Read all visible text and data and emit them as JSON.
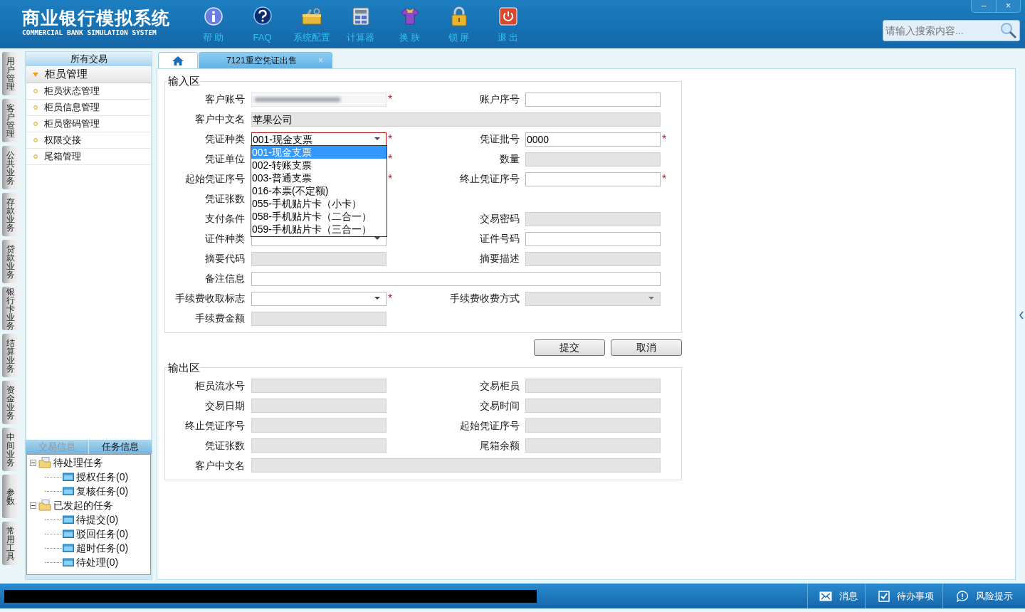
{
  "header": {
    "title": "商业银行模拟系统",
    "subtitle": "COMMERCIAL BANK SIMULATION SYSTEM",
    "toolbar": [
      {
        "label": "帮 助"
      },
      {
        "label": "FAQ"
      },
      {
        "label": "系统配置"
      },
      {
        "label": "计算器"
      },
      {
        "label": "换 肤"
      },
      {
        "label": "锁 屏"
      },
      {
        "label": "退 出"
      }
    ],
    "window_controls": [
      "–",
      "×"
    ],
    "search": {
      "placeholder": "请输入搜索内容..."
    }
  },
  "side_tabs": [
    {
      "label": "用户管理"
    },
    {
      "label": "客户管理"
    },
    {
      "label": "公共业务"
    },
    {
      "label": "存款业务"
    },
    {
      "label": "贷款业务"
    },
    {
      "label": "银行卡业务"
    },
    {
      "label": "结算业务"
    },
    {
      "label": "资金业务"
    },
    {
      "label": "中间业务"
    },
    {
      "label": "参数"
    },
    {
      "label": "常用工具"
    }
  ],
  "sidebar": {
    "title": "所有交易",
    "group": {
      "label": "柜员管理",
      "expanded": true,
      "items": [
        "柜员状态管理",
        "柜员信息管理",
        "柜员密码管理",
        "权限交接",
        "尾箱管理"
      ]
    },
    "info_tabs": [
      {
        "label": "交易信息",
        "selected": false
      },
      {
        "label": "任务信息",
        "selected": true
      }
    ],
    "tree": [
      {
        "label": "待处理任务",
        "expanded": true,
        "children": [
          {
            "label": "授权任务(0)"
          },
          {
            "label": "复核任务(0)"
          }
        ]
      },
      {
        "label": "已发起的任务",
        "expanded": true,
        "children": [
          {
            "label": "待提交(0)"
          },
          {
            "label": "驳回任务(0)"
          },
          {
            "label": "超时任务(0)"
          },
          {
            "label": "待处理(0)"
          }
        ]
      }
    ]
  },
  "tabs": [
    {
      "kind": "home",
      "selected": false
    },
    {
      "kind": "text",
      "label": "7121重空凭证出售",
      "close": "×",
      "selected": true
    }
  ],
  "required_mark": "*",
  "input_area": {
    "title": "输入区",
    "rows": [
      {
        "left": {
          "label": "客户账号",
          "kind": "masked",
          "required": true
        },
        "right": {
          "label": "账户序号",
          "kind": "text",
          "disabled": false
        }
      },
      {
        "wide": {
          "label": "客户中文名",
          "kind": "text",
          "value": "苹果公司",
          "disabled": true
        }
      },
      {
        "left": {
          "label": "凭证种类",
          "kind": "select",
          "value": "001-现金支票",
          "disabled": false,
          "required": true,
          "open": true,
          "options": [
            {
              "label": "001-现金支票",
              "selected": true
            },
            {
              "label": "002-转账支票",
              "selected": false
            },
            {
              "label": "003-普通支票",
              "selected": false
            },
            {
              "label": "016-本票(不定额)",
              "selected": false
            },
            {
              "label": "055-手机贴片卡（小卡）",
              "selected": false
            },
            {
              "label": "058-手机贴片卡（二合一）",
              "selected": false
            },
            {
              "label": "059-手机贴片卡（三合一）",
              "selected": false
            }
          ]
        },
        "right": {
          "label": "凭证批号",
          "kind": "text",
          "value": "0000",
          "disabled": false,
          "required": true
        }
      },
      {
        "left": {
          "label": "凭证单位",
          "kind": "covered",
          "required": true
        },
        "right": {
          "label": "数量",
          "kind": "text",
          "disabled": true
        }
      },
      {
        "left": {
          "label": "起始凭证序号",
          "kind": "covered",
          "required": true
        },
        "right": {
          "label": "终止凭证序号",
          "kind": "text",
          "disabled": false,
          "required": true
        }
      },
      {
        "left": {
          "label": "凭证张数",
          "kind": "covered"
        }
      },
      {
        "left": {
          "label": "支付条件",
          "kind": "covered"
        },
        "right": {
          "label": "交易密码",
          "kind": "text",
          "disabled": true
        }
      },
      {
        "left": {
          "label": "证件种类",
          "kind": "select",
          "disabled": false
        },
        "right": {
          "label": "证件号码",
          "kind": "text",
          "disabled": false
        }
      },
      {
        "left": {
          "label": "摘要代码",
          "kind": "text",
          "disabled": true
        },
        "right": {
          "label": "摘要描述",
          "kind": "text",
          "disabled": true
        }
      },
      {
        "wide": {
          "label": "备注信息",
          "kind": "text",
          "disabled": false
        }
      },
      {
        "left": {
          "label": "手续费收取标志",
          "kind": "select",
          "disabled": false,
          "required": true
        },
        "right": {
          "label": "手续费收费方式",
          "kind": "select",
          "disabled": true
        }
      },
      {
        "left": {
          "label": "手续费金额",
          "kind": "text",
          "disabled": true
        }
      }
    ]
  },
  "buttons": [
    "提交",
    "取消"
  ],
  "output_area": {
    "title": "输出区",
    "rows": [
      {
        "left": {
          "label": "柜员流水号",
          "kind": "text",
          "disabled": true
        },
        "right": {
          "label": "交易柜员",
          "kind": "text",
          "disabled": true
        }
      },
      {
        "left": {
          "label": "交易日期",
          "kind": "text",
          "disabled": true
        },
        "right": {
          "label": "交易时间",
          "kind": "text",
          "disabled": true
        }
      },
      {
        "left": {
          "label": "终止凭证序号",
          "kind": "text",
          "disabled": true
        },
        "right": {
          "label": "起始凭证序号",
          "kind": "text",
          "disabled": true
        }
      },
      {
        "left": {
          "label": "凭证张数",
          "kind": "text",
          "disabled": true
        },
        "right": {
          "label": "尾箱余额",
          "kind": "text",
          "disabled": true
        }
      },
      {
        "wide": {
          "label": "客户中文名",
          "kind": "text",
          "disabled": true
        }
      }
    ]
  },
  "status_bar": {
    "items": [
      {
        "label": "消息"
      },
      {
        "label": "待办事项"
      },
      {
        "label": "风险提示"
      }
    ]
  }
}
